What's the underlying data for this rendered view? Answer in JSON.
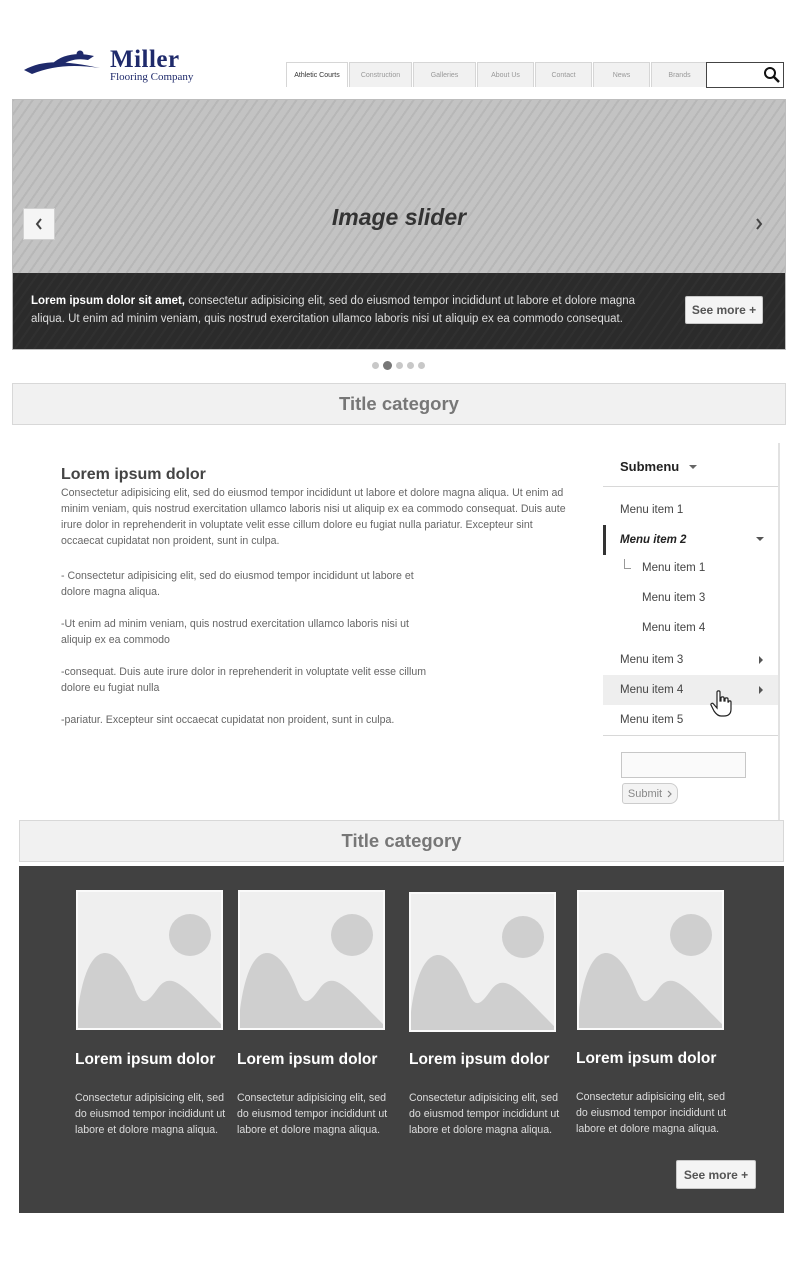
{
  "header": {
    "logo_name": "Miller",
    "logo_sub": "Flooring Company",
    "nav": [
      "Athletic Courts",
      "Construction",
      "Galleries",
      "About Us",
      "Contact",
      "News",
      "Brands"
    ],
    "search_placeholder": ""
  },
  "slider": {
    "title": "Image slider",
    "caption_bold": "Lorem ipsum dolor sit amet,",
    "caption_rest": " consectetur adipisicing elit, sed do eiusmod tempor incididunt ut labore et dolore magna aliqua. Ut enim ad minim veniam, quis nostrud exercitation ullamco laboris nisi ut aliquip ex ea commodo consequat.",
    "see_more": "See more +",
    "dots": 5,
    "active_dot": 2
  },
  "section1": {
    "title": "Title category"
  },
  "article": {
    "title": "Lorem ipsum dolor",
    "intro": "Consectetur adipisicing elit, sed do eiusmod tempor incididunt ut labore et dolore magna aliqua. Ut enim ad minim veniam, quis nostrud exercitation ullamco laboris nisi ut aliquip ex ea commodo consequat. Duis aute irure dolor in reprehenderit in voluptate velit esse cillum dolore eu fugiat nulla pariatur. Excepteur sint occaecat cupidatat non proident, sunt in culpa.",
    "bullets": [
      "- Consectetur adipisicing elit, sed do eiusmod tempor incididunt ut labore et dolore magna aliqua.",
      " -Ut enim ad minim veniam, quis nostrud exercitation ullamco laboris nisi ut aliquip ex ea commodo",
      "-consequat. Duis aute irure dolor in reprehenderit in voluptate velit esse cillum dolore eu fugiat nulla",
      "-pariatur. Excepteur sint occaecat cupidatat non proident, sunt in culpa."
    ]
  },
  "submenu": {
    "title": "Submenu",
    "items": [
      {
        "label": "Menu item 1"
      },
      {
        "label": "Menu item 2"
      },
      {
        "label": "Menu item 1"
      },
      {
        "label": "Menu item 3"
      },
      {
        "label": "Menu item 4"
      },
      {
        "label": "Menu item 3"
      },
      {
        "label": "Menu item 4"
      },
      {
        "label": "Menu item 5"
      }
    ],
    "submit": "Submit"
  },
  "section2": {
    "title": "Title category"
  },
  "gallery": {
    "cards": [
      {
        "title": "Lorem ipsum dolor",
        "text": "Consectetur adipisicing elit, sed do eiusmod tempor incididunt ut labore et dolore magna aliqua."
      },
      {
        "title": "Lorem ipsum dolor",
        "text": "Consectetur adipisicing elit, sed do eiusmod tempor incididunt ut labore et dolore magna aliqua."
      },
      {
        "title": "Lorem ipsum dolor",
        "text": "Consectetur adipisicing elit, sed do eiusmod tempor incididunt ut labore et dolore magna aliqua."
      },
      {
        "title": "Lorem ipsum dolor",
        "text": "Consectetur adipisicing elit, sed do eiusmod tempor incididunt ut labore et dolore magna aliqua."
      }
    ],
    "see_more": "See more +"
  }
}
